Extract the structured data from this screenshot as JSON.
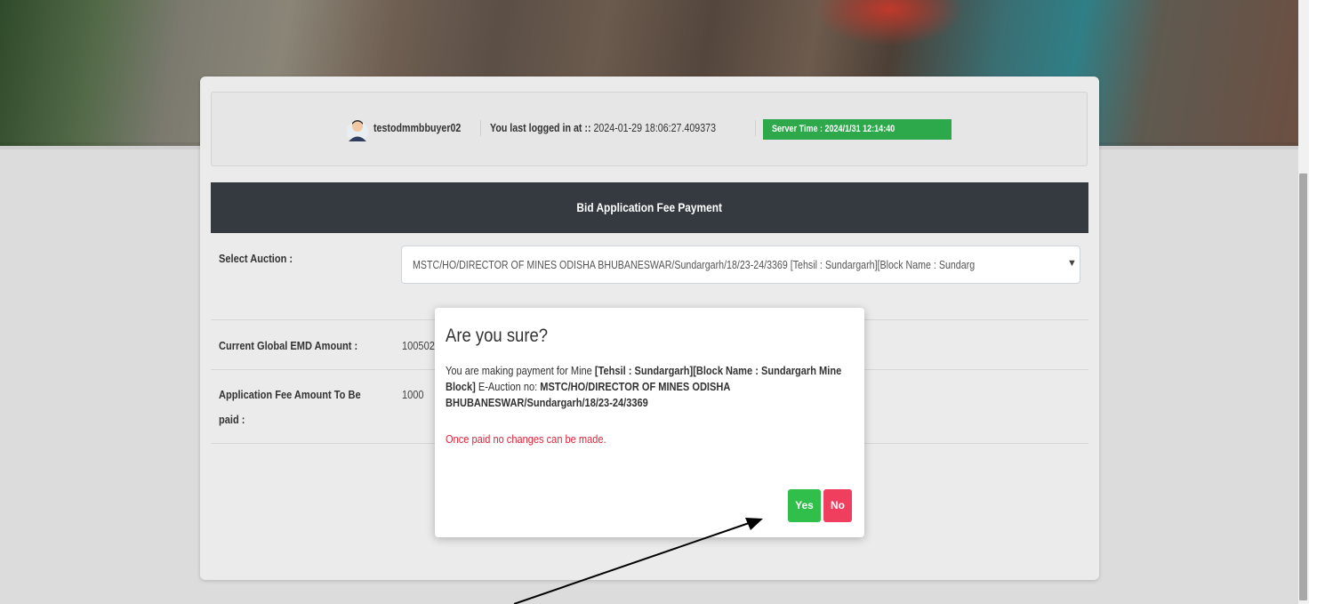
{
  "header": {
    "username": "testodmmbbuyer02",
    "last_login_label": "You last logged in at ::",
    "last_login_value": "2024-01-29 18:06:27.409373",
    "server_time": "Server Time : 2024/1/31 12:14:40"
  },
  "section": {
    "title": "Bid Application Fee Payment"
  },
  "form": {
    "select_auction_label": "Select Auction :",
    "select_auction_value": "MSTC/HO/DIRECTOR OF MINES ODISHA BHUBANESWAR/Sundargarh/18/23-24/3369 [Tehsil : Sundargarh][Block Name : Sundarg",
    "emd_label": "Current Global EMD Amount :",
    "emd_value": "100502",
    "fee_label_line1": "Application Fee Amount To Be",
    "fee_label_line2": "paid :",
    "fee_value": "1000"
  },
  "modal": {
    "title": "Are you sure?",
    "body_prefix": "You are making payment for Mine",
    "body_mine": "[Tehsil : Sundargarh][Block Name : Sundargarh Mine Block]",
    "body_mid": "E-Auction no:",
    "body_auction": "MSTC/HO/DIRECTOR OF MINES ODISHA BHUBANESWAR/Sundargarh/18/23-24/3369",
    "warning": "Once paid no changes can be made.",
    "yes_label": "Yes",
    "no_label": "No"
  },
  "colors": {
    "server_time_bg": "#2da84a",
    "header_bar_bg": "#343a40",
    "yes_bg": "#2fbf4a",
    "no_bg": "#f03e5f",
    "warning_text": "#e0243a"
  },
  "icons": {
    "avatar": "user-avatar-icon",
    "select_chevron": "chevron-down-icon",
    "annotation": "arrow-annotation-icon"
  }
}
